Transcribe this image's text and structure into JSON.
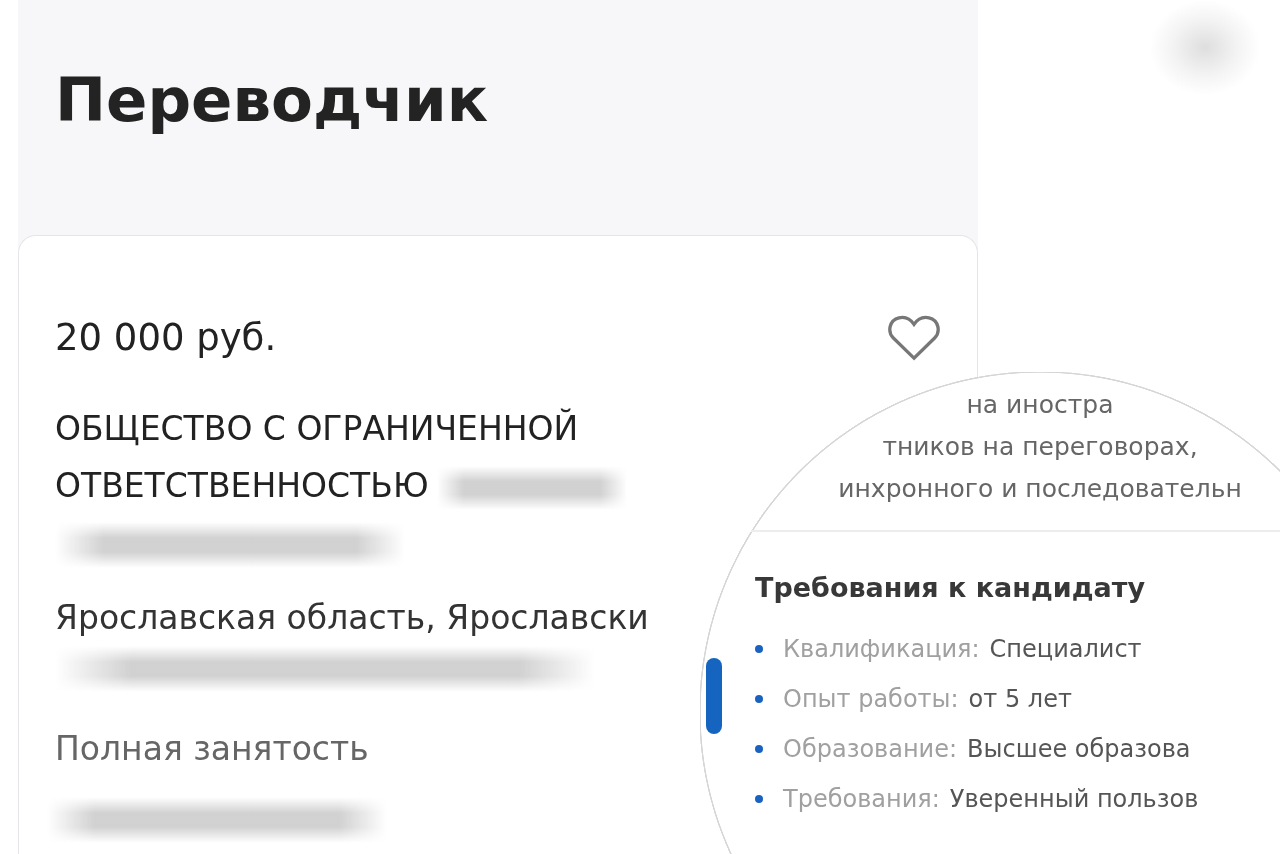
{
  "header": {
    "title": "Переводчик"
  },
  "card": {
    "salary": "20 000 руб.",
    "saved": false,
    "company": {
      "name": "ОБЩЕСТВО С ОГРАНИЧЕННОЙ ОТВЕТСТВЕННОСТЬЮ",
      "blurred": true
    },
    "details": [
      {
        "kind": "redacted"
      },
      {
        "kind": "address",
        "text": "Ярославская область, Ярославски"
      },
      {
        "kind": "redacted"
      },
      {
        "kind": "employment",
        "text": "Полная занятость"
      },
      {
        "kind": "redacted"
      }
    ]
  },
  "magnifier": {
    "description_lines": [
      "на иностра",
      "тников на переговорах,",
      "инхронного и последовательн"
    ],
    "section_title": "Требования к кандидату",
    "requirements": [
      {
        "label": "Квалификация:",
        "value": "Специалист"
      },
      {
        "label": "Опыт работы:",
        "value": "от 5 лет"
      },
      {
        "label": "Образование:",
        "value": "Высшее образова"
      },
      {
        "label": "Требования:",
        "value": "Уверенный пользов"
      }
    ]
  }
}
